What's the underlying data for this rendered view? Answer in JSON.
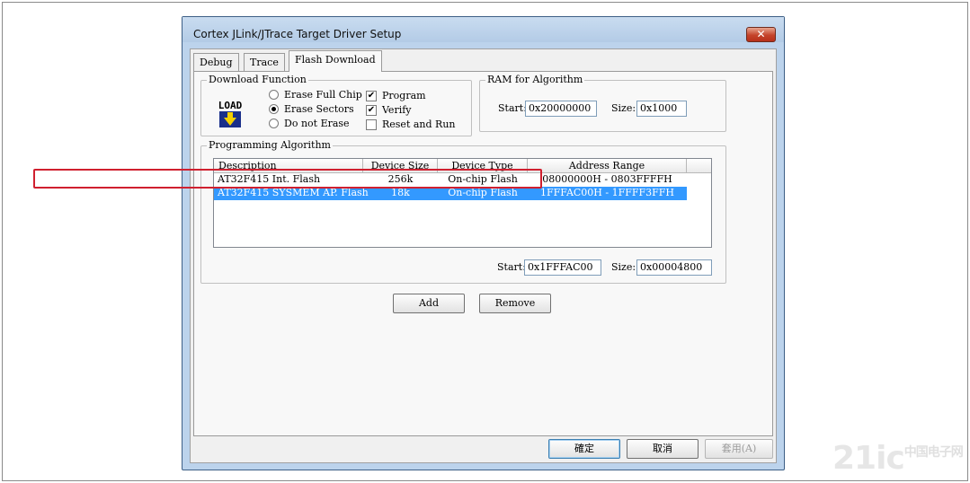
{
  "window": {
    "title": "Cortex JLink/JTrace Target Driver Setup",
    "close_label": "✕"
  },
  "tabs": [
    {
      "label": "Debug"
    },
    {
      "label": "Trace"
    },
    {
      "label": "Flash Download",
      "active": true
    }
  ],
  "download_function": {
    "legend": "Download Function",
    "icon_text": "LOAD",
    "radios": [
      {
        "label": "Erase Full Chip",
        "checked": false
      },
      {
        "label": "Erase Sectors",
        "checked": true
      },
      {
        "label": "Do not Erase",
        "checked": false
      }
    ],
    "checks": [
      {
        "label": "Program",
        "checked": true
      },
      {
        "label": "Verify",
        "checked": true
      },
      {
        "label": "Reset and Run",
        "checked": false
      }
    ]
  },
  "ram": {
    "legend": "RAM for Algorithm",
    "start_label": "Start:",
    "start_value": "0x20000000",
    "size_label": "Size:",
    "size_value": "0x1000"
  },
  "programming": {
    "legend": "Programming Algorithm",
    "columns": [
      "Description",
      "Device Size",
      "Device Type",
      "Address Range"
    ],
    "rows": [
      {
        "description": "AT32F415 Int. Flash",
        "size": "256k",
        "type": "On-chip Flash",
        "range": "08000000H - 0803FFFFH",
        "selected": false
      },
      {
        "description": "AT32F415 SYSMEM AP. Flash",
        "size": "18k",
        "type": "On-chip Flash",
        "range": "1FFFAC00H - 1FFFF3FFH",
        "selected": true
      }
    ],
    "start_label": "Start:",
    "start_value": "0x1FFFAC00",
    "size_label": "Size:",
    "size_value": "0x00004800"
  },
  "buttons": {
    "add": "Add",
    "remove": "Remove",
    "ok": "確定",
    "cancel": "取消",
    "apply": "套用(A)"
  },
  "watermark": {
    "text": "21ic",
    "sub": "中国电子网"
  }
}
